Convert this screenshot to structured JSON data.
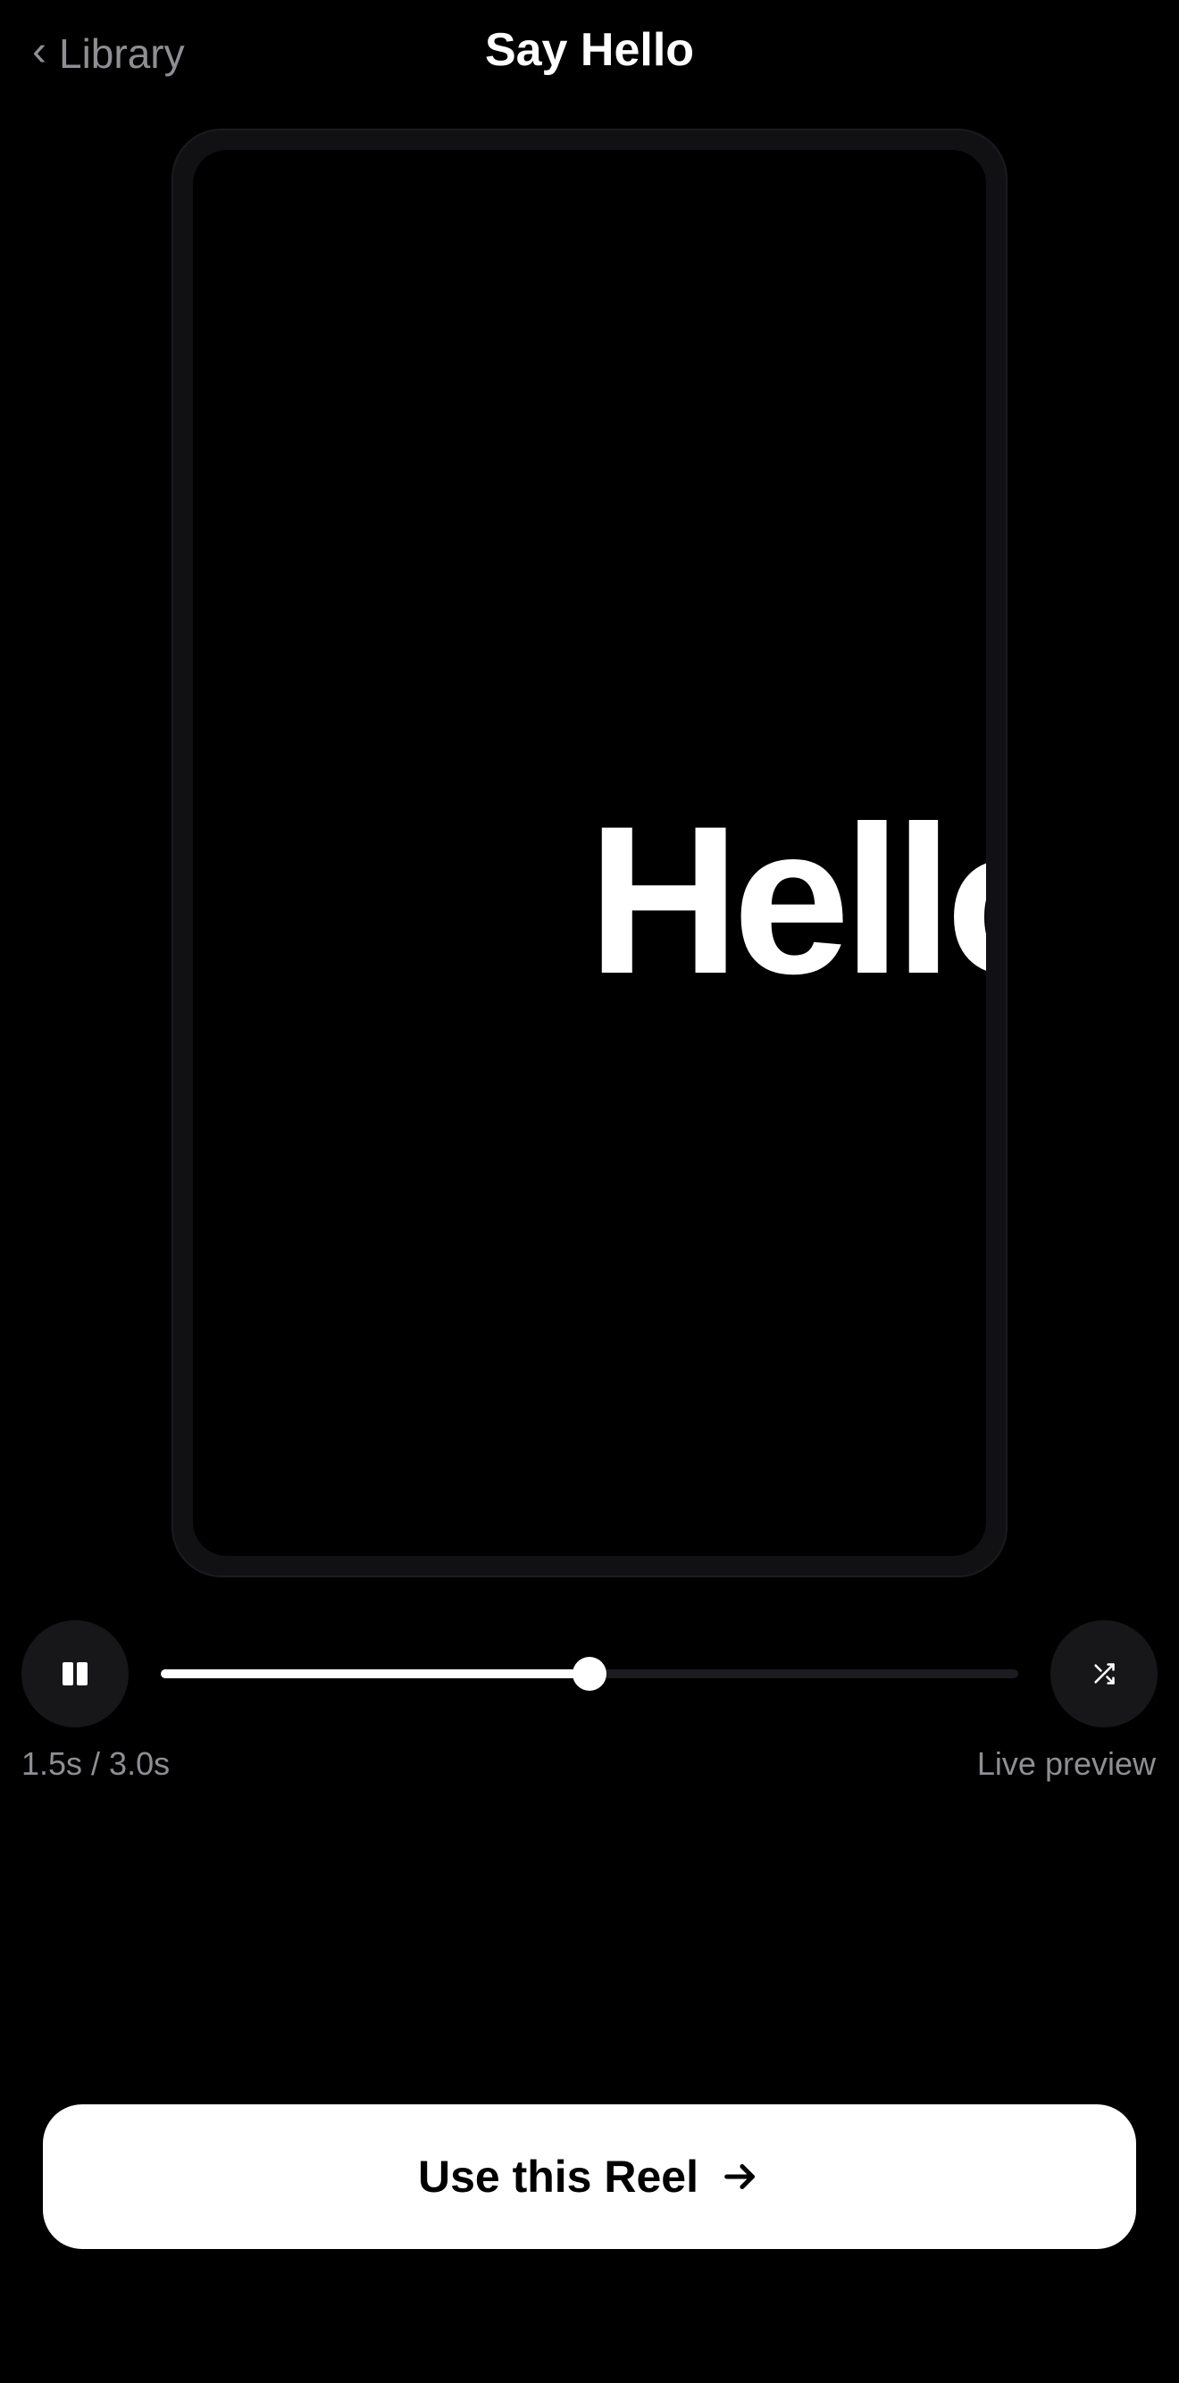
{
  "header": {
    "back_chevron": "‹",
    "back_label": "Library",
    "title": "Say Hello"
  },
  "preview": {
    "word": "Hello"
  },
  "playback": {
    "state": "playing",
    "current_time": "1.5s",
    "duration": "3.0s",
    "time_text": "1.5s / 3.0s",
    "progress": 0.5,
    "status": "Live preview"
  },
  "icons": {
    "pause": "pause-icon",
    "shuffle": "shuffle-icon",
    "back": "chevron-left-icon",
    "cta": "arrow-right-icon"
  },
  "cta": {
    "label": "Use this Reel"
  },
  "colors": {
    "background": "#000000",
    "muted_text": "#8e8e93",
    "control_bg": "#17171a",
    "cta_bg": "#ffffff",
    "cta_text": "#000000"
  }
}
